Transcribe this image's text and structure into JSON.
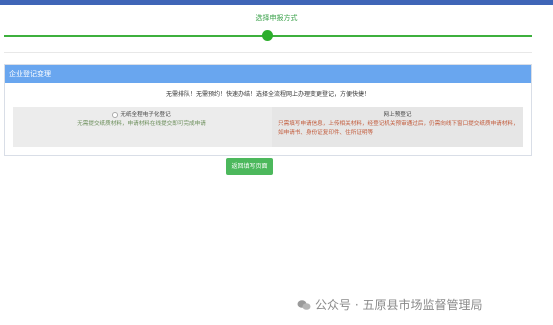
{
  "header": {
    "step_title": "选择申报方式"
  },
  "panel": {
    "title": "企业登记变理",
    "notice": "无需排队！无需预约！快速办结！选择全流程网上办理变更登记，方便快捷！",
    "options": [
      {
        "title": "无纸全程电子化登记",
        "desc": "无需提交纸质材料，申请材料在线提交即可完成申请"
      },
      {
        "title": "网上预登记",
        "desc": "只需填写申请信息，上传相关材料，经登记机关预审通过后，仍需向线下窗口提交纸质申请材料，如申请书、身份证复印件、住所证明等"
      }
    ]
  },
  "actions": {
    "back_label": "返回填写页面"
  },
  "watermark": {
    "text": "公众号 · 五原县市场监督管理局"
  },
  "colors": {
    "accent_blue": "#3f65b7",
    "header_blue": "#69a6ef",
    "green": "#4cb85c"
  }
}
